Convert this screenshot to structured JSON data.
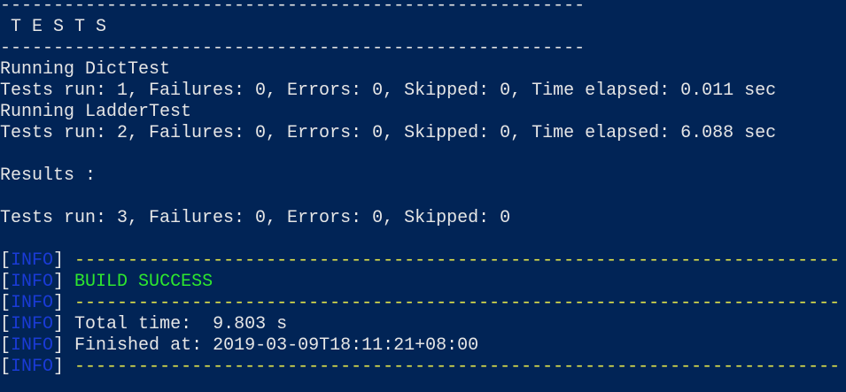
{
  "colors": {
    "background": "#012456",
    "text": "#e6e6e6",
    "info": "#1a3bd6",
    "dash_yellow": "#e8e84a",
    "success": "#2ee62e"
  },
  "lines": {
    "sep_short": "-------------------------------------------------------",
    "tests_header": " T E S T S",
    "running1": "Running DictTest",
    "result1": "Tests run: 1, Failures: 0, Errors: 0, Skipped: 0, Time elapsed: 0.011 sec",
    "running2": "Running LadderTest",
    "result2": "Tests run: 2, Failures: 0, Errors: 0, Skipped: 0, Time elapsed: 6.088 sec",
    "results_label": "Results :",
    "summary": "Tests run: 3, Failures: 0, Errors: 0, Skipped: 0"
  },
  "info": {
    "lbracket": "[",
    "tag": "INFO",
    "rbracket": "] ",
    "sep_long": "------------------------------------------------------------------------",
    "build_status": "BUILD SUCCESS",
    "total_time": "Total time:  9.803 s",
    "finished_at": "Finished at: 2019-03-09T18:11:21+08:00"
  }
}
